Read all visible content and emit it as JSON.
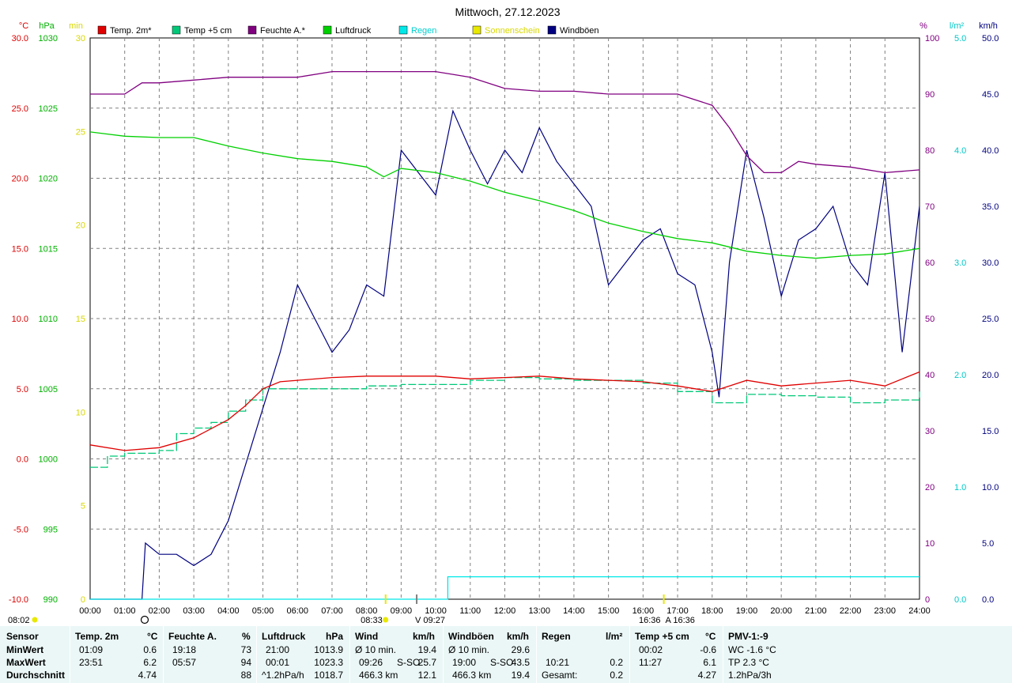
{
  "title": "Mittwoch, 27.12.2023",
  "legend": [
    {
      "name": "Temp. 2m*",
      "color": "#e00000"
    },
    {
      "name": "Temp +5 cm",
      "color": "#00c878"
    },
    {
      "name": "Feuchte A.*",
      "color": "#800080"
    },
    {
      "name": "Luftdruck",
      "color": "#00d000"
    },
    {
      "name": "Regen",
      "color": "#00e8e8"
    },
    {
      "name": "Sonnenschein",
      "color": "#e8e800"
    },
    {
      "name": "Windböen",
      "color": "#000080"
    }
  ],
  "axes": {
    "temp": {
      "unit": "°C",
      "color": "#e00000",
      "ticks": [
        "30.0",
        "25.0",
        "20.0",
        "15.0",
        "10.0",
        "5.0",
        "0.0",
        "-5.0",
        "-10.0"
      ]
    },
    "pressure": {
      "unit": "hPa",
      "color": "#00b000",
      "ticks": [
        "1030",
        "1025",
        "1020",
        "1015",
        "1010",
        "1005",
        "1000",
        "995",
        "990"
      ]
    },
    "sun_min": {
      "unit": "min",
      "color": "#d8d800",
      "ticks": [
        "30",
        "25",
        "20",
        "15",
        "10",
        "5",
        "0"
      ]
    },
    "humidity": {
      "unit": "%",
      "color": "#800080",
      "ticks": [
        "100",
        "90",
        "80",
        "70",
        "60",
        "50",
        "40",
        "30",
        "20",
        "10",
        "0"
      ]
    },
    "rain": {
      "unit": "l/m²",
      "color": "#00c8c8",
      "ticks": [
        "5.0",
        "4.0",
        "3.0",
        "2.0",
        "1.0",
        "0.0"
      ]
    },
    "wind": {
      "unit": "km/h",
      "color": "#000080",
      "ticks": [
        "50.0",
        "45.0",
        "40.0",
        "35.0",
        "30.0",
        "25.0",
        "20.0",
        "15.0",
        "10.0",
        "5.0",
        "0.0"
      ]
    },
    "x_ticks": [
      "00:00",
      "01:00",
      "02:00",
      "03:00",
      "04:00",
      "05:00",
      "06:00",
      "07:00",
      "08:00",
      "09:00",
      "10:00",
      "11:00",
      "12:00",
      "13:00",
      "14:00",
      "15:00",
      "16:00",
      "17:00",
      "18:00",
      "19:00",
      "20:00",
      "21:00",
      "22:00",
      "23:00",
      "24:00"
    ]
  },
  "markers": {
    "sunrise": "08:02",
    "sunrise_label": "08:33",
    "noon": "09:27",
    "sunset_a": "16:36",
    "sunset_b": "16:36"
  },
  "colors": {
    "grid": "#808080",
    "table_bg": "#eaf7f6"
  },
  "chart_data": {
    "type": "line",
    "title": "Mittwoch, 27.12.2023",
    "x_unit": "hour of day",
    "xlim": [
      0,
      24
    ],
    "grid": true,
    "legend_position": "top",
    "series": [
      {
        "name": "Temp. 2m*",
        "axis": "temp",
        "ylim": [
          -10,
          30
        ],
        "x": [
          0,
          1,
          2,
          3,
          4,
          4.5,
          5,
          5.5,
          6,
          7,
          8,
          9,
          10,
          11,
          12,
          13,
          14,
          15,
          16,
          17,
          18,
          18.5,
          19,
          20,
          21,
          22,
          23,
          24
        ],
        "values": [
          1.0,
          0.6,
          0.8,
          1.5,
          2.8,
          3.8,
          5.0,
          5.5,
          5.6,
          5.8,
          5.9,
          5.9,
          5.9,
          5.7,
          5.8,
          5.9,
          5.7,
          5.6,
          5.5,
          5.2,
          4.8,
          5.2,
          5.6,
          5.2,
          5.4,
          5.6,
          5.2,
          6.2
        ]
      },
      {
        "name": "Temp +5 cm",
        "axis": "temp",
        "ylim": [
          -10,
          30
        ],
        "x": [
          0,
          0.5,
          1,
          2,
          2.5,
          3,
          3.5,
          4,
          4.5,
          5,
          6,
          7,
          8,
          9,
          10,
          11,
          12,
          13,
          14,
          15,
          16,
          17,
          18,
          19,
          20,
          21,
          22,
          23,
          24
        ],
        "values": [
          -0.6,
          0.2,
          0.4,
          0.6,
          1.8,
          2.2,
          2.6,
          3.4,
          4.2,
          5.0,
          5.0,
          5.0,
          5.2,
          5.3,
          5.3,
          5.6,
          5.8,
          5.7,
          5.6,
          5.6,
          5.4,
          4.8,
          4.0,
          4.6,
          4.5,
          4.4,
          4.0,
          4.2,
          4.8
        ]
      },
      {
        "name": "Feuchte A.*",
        "axis": "humidity",
        "ylim": [
          0,
          100
        ],
        "x": [
          0,
          1,
          1.5,
          2,
          3,
          4,
          5,
          6,
          7,
          8,
          9,
          10,
          10.5,
          11,
          12,
          13,
          14,
          15,
          16,
          17,
          17.5,
          18,
          18.5,
          19,
          19.5,
          20,
          20.5,
          21,
          22,
          23,
          24
        ],
        "values": [
          90,
          90,
          92,
          92,
          92.5,
          93,
          93,
          93,
          94,
          94,
          94,
          94,
          93.5,
          93,
          91,
          90.5,
          90.5,
          90,
          90,
          90,
          89,
          88,
          84,
          79,
          76,
          76,
          78,
          77.5,
          77,
          76,
          76.5
        ]
      },
      {
        "name": "Luftdruck",
        "axis": "pressure",
        "ylim": [
          990,
          1030
        ],
        "x": [
          0,
          1,
          2,
          3,
          4,
          5,
          6,
          7,
          8,
          8.5,
          9,
          10,
          11,
          12,
          13,
          14,
          15,
          16,
          17,
          18,
          19,
          20,
          21,
          22,
          23,
          24
        ],
        "values": [
          1023.3,
          1023.0,
          1022.9,
          1022.9,
          1022.3,
          1021.8,
          1021.4,
          1021.2,
          1020.8,
          1020.1,
          1020.7,
          1020.4,
          1019.8,
          1019.0,
          1018.4,
          1017.7,
          1016.8,
          1016.2,
          1015.7,
          1015.4,
          1014.8,
          1014.5,
          1014.3,
          1014.5,
          1014.6,
          1015.0
        ]
      },
      {
        "name": "Regen",
        "axis": "rain",
        "ylim": [
          0,
          5
        ],
        "x": [
          0,
          10.2,
          10.35,
          24
        ],
        "values": [
          0,
          0,
          0.2,
          0.2
        ]
      },
      {
        "name": "Windböen",
        "axis": "wind",
        "ylim": [
          0,
          50
        ],
        "x": [
          0,
          1.5,
          1.6,
          2,
          2.5,
          3,
          3.5,
          4,
          4.2,
          4.5,
          5,
          5.5,
          6,
          6.5,
          7,
          7.5,
          8,
          8.5,
          9,
          9.5,
          10,
          10.5,
          11,
          11.5,
          12,
          12.5,
          13,
          13.5,
          14,
          14.5,
          15,
          15.5,
          16,
          16.5,
          17,
          17.5,
          18,
          18.2,
          18.5,
          19,
          19.5,
          20,
          20.5,
          21,
          21.5,
          22,
          22.5,
          23,
          23.5,
          24
        ],
        "values": [
          0,
          0,
          5,
          4,
          4,
          3,
          4,
          7,
          9,
          12,
          17,
          22,
          28,
          25,
          22,
          24,
          28,
          27,
          40,
          38,
          36,
          43.5,
          40,
          37,
          40,
          38,
          42,
          39,
          37,
          35,
          28,
          30,
          32,
          33,
          29,
          28,
          22,
          18,
          30,
          40,
          34,
          27,
          32,
          33,
          35,
          30,
          28,
          38,
          22,
          35
        ]
      }
    ]
  },
  "summary": {
    "sensor": {
      "title": "Sensor",
      "rows": [
        "MinWert",
        "MaxWert",
        "Durchschnitt"
      ]
    },
    "temp2m": {
      "title": "Temp. 2m",
      "unit": "°C",
      "min_time": "01:09",
      "min_val": "0.6",
      "max_time": "23:51",
      "max_val": "6.2",
      "avg": "4.74"
    },
    "feuchte": {
      "title": "Feuchte A.",
      "unit": "%",
      "min_time": "19:18",
      "min_val": "73",
      "max_time": "05:57",
      "max_val": "94",
      "avg": "88"
    },
    "luftdruck": {
      "title": "Luftdruck",
      "unit": "hPa",
      "min_time": "21:00",
      "min_val": "1013.9",
      "max_time": "00:01",
      "max_val": "1023.3",
      "avg_label": "^1.2hPa/h",
      "avg": "1018.7"
    },
    "wind": {
      "title": "Wind",
      "unit": "km/h",
      "min_label": "Ø 10 min.",
      "min_val": "19.4",
      "max_time": "09:26",
      "max_dir": "S-SO",
      "max_val": "25.7",
      "avg_label": "466.3 km",
      "avg": "12.1"
    },
    "windboeen": {
      "title": "Windböen",
      "unit": "km/h",
      "min_label": "Ø 10 min.",
      "min_val": "29.6",
      "max_time": "19:00",
      "max_dir": "S-SO",
      "max_val": "43.5",
      "avg_label": "466.3 km",
      "avg": "19.4"
    },
    "regen": {
      "title": "Regen",
      "unit": "l/m²",
      "max_time": "10:21",
      "max_val": "0.2",
      "avg_label": "Gesamt:",
      "avg": "0.2"
    },
    "temp5cm": {
      "title": "Temp +5 cm",
      "unit": "°C",
      "min_time": "00:02",
      "min_val": "-0.6",
      "max_time": "11:27",
      "max_val": "6.1",
      "avg": "4.27"
    },
    "pmv": {
      "title": "PMV-1:-9",
      "line1": "WC -1.6 °C",
      "line2": "TP 2.3 °C",
      "line3": "1.2hPa/3h"
    }
  }
}
